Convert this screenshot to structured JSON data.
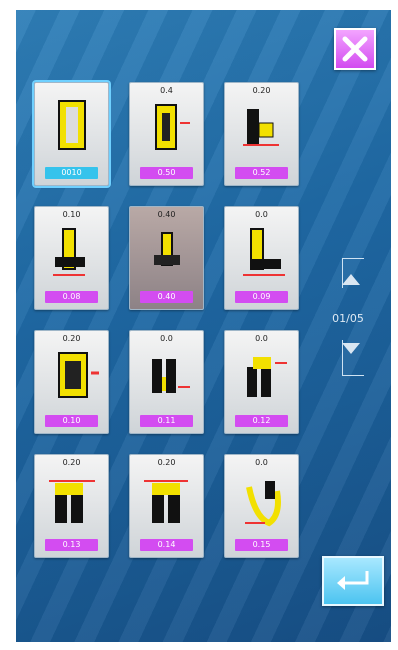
{
  "header": {
    "close_icon": "close-x-icon",
    "close_color": "#d24bf0"
  },
  "patterns": [
    {
      "code": "",
      "badge": "0010",
      "selected": true,
      "badge_color": "cyan"
    },
    {
      "code": "0.4",
      "badge": "0.50",
      "selected": false
    },
    {
      "code": "0.20",
      "badge": "0.52",
      "selected": false
    },
    {
      "code": "0.10",
      "badge": "0.08",
      "selected": false
    },
    {
      "code": "0.40",
      "badge": "0.40",
      "selected": false,
      "dark": true
    },
    {
      "code": "0.0",
      "badge": "0.09",
      "selected": false
    },
    {
      "code": "0.20",
      "badge": "0.10",
      "selected": false
    },
    {
      "code": "0.0",
      "badge": "0.11",
      "selected": false
    },
    {
      "code": "0.0",
      "badge": "0.12",
      "selected": false
    },
    {
      "code": "0.20",
      "badge": "0.13",
      "selected": false
    },
    {
      "code": "0.20",
      "badge": "0.14",
      "selected": false
    },
    {
      "code": "0.0",
      "badge": "0.15",
      "selected": false
    }
  ],
  "pager": {
    "indicator": "01/05",
    "up_icon": "arrow-up-icon",
    "down_icon": "arrow-down-icon"
  },
  "footer": {
    "enter_icon": "enter-return-icon",
    "enter_color": "#4cc4f0"
  }
}
